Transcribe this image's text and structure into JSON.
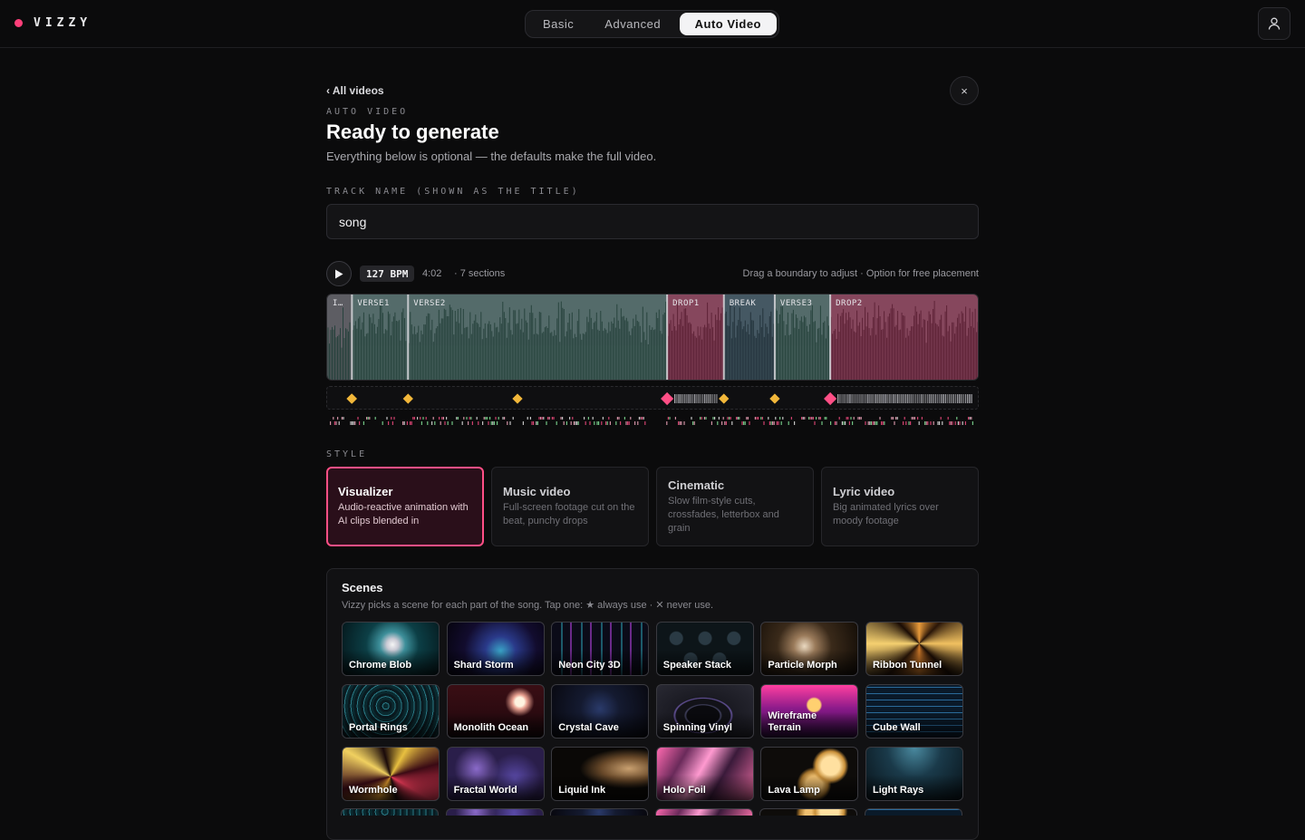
{
  "app": {
    "brand": "VIZZY",
    "brand_color": "#ff3f7a",
    "modes": [
      "Basic",
      "Advanced",
      "Auto Video"
    ],
    "active_mode": "Auto Video"
  },
  "header": {
    "back_label": "‹ All videos",
    "eyebrow": "AUTO VIDEO",
    "title": "Ready to generate",
    "subtitle": "Everything below is optional — the defaults make the full video.",
    "close_icon": "×"
  },
  "track": {
    "label": "TRACK NAME (SHOWN AS THE TITLE)",
    "value": "song"
  },
  "player": {
    "bpm": "127 BPM",
    "duration": "4:02",
    "sections_count": "· 7 sections",
    "hint": "Drag a boundary to adjust · Option for free placement"
  },
  "sections": [
    {
      "label": "I…",
      "start": 0.0,
      "end": 0.038,
      "kind": "intro"
    },
    {
      "label": "VERSE1",
      "start": 0.038,
      "end": 0.124,
      "kind": "verse"
    },
    {
      "label": "VERSE2",
      "start": 0.124,
      "end": 0.521,
      "kind": "verse"
    },
    {
      "label": "DROP1",
      "start": 0.521,
      "end": 0.608,
      "kind": "drop"
    },
    {
      "label": "BREAK",
      "start": 0.608,
      "end": 0.686,
      "kind": "break"
    },
    {
      "label": "VERSE3",
      "start": 0.686,
      "end": 0.771,
      "kind": "verse"
    },
    {
      "label": "DROP2",
      "start": 0.771,
      "end": 1.0,
      "kind": "drop"
    }
  ],
  "colors": {
    "intro": "#6a6a70",
    "verse": "#5f7a78",
    "drop": "#9a5068",
    "break": "#4e6470",
    "accent": "#ff4f86",
    "marker": "#f2b73a"
  },
  "style": {
    "label": "STYLE",
    "options": [
      {
        "name": "Visualizer",
        "desc": "Audio-reactive animation with AI clips blended in",
        "selected": true
      },
      {
        "name": "Music video",
        "desc": "Full-screen footage cut on the beat, punchy drops",
        "selected": false
      },
      {
        "name": "Cinematic",
        "desc": "Slow film-style cuts, crossfades, letterbox and grain",
        "selected": false
      },
      {
        "name": "Lyric video",
        "desc": "Big animated lyrics over moody footage",
        "selected": false
      }
    ]
  },
  "scenes": {
    "title": "Scenes",
    "hint": "Vizzy picks a scene for each part of the song. Tap one: ★ always use · ✕ never use.",
    "items": [
      {
        "name": "Chrome Blob",
        "bg": "bg-chrome-blob"
      },
      {
        "name": "Shard Storm",
        "bg": "bg-shard-storm"
      },
      {
        "name": "Neon City 3D",
        "bg": "bg-neon-city"
      },
      {
        "name": "Speaker Stack",
        "bg": "bg-speaker-stack"
      },
      {
        "name": "Particle Morph",
        "bg": "bg-particle-morph"
      },
      {
        "name": "Ribbon Tunnel",
        "bg": "bg-ribbon-tunnel"
      },
      {
        "name": "Portal Rings",
        "bg": "bg-portal-rings"
      },
      {
        "name": "Monolith Ocean",
        "bg": "bg-monolith-ocean"
      },
      {
        "name": "Crystal Cave",
        "bg": "bg-crystal-cave"
      },
      {
        "name": "Spinning Vinyl",
        "bg": "bg-spinning-vinyl"
      },
      {
        "name": "Wireframe Terrain",
        "bg": "bg-wireframe-terrain"
      },
      {
        "name": "Cube Wall",
        "bg": "bg-cube-wall"
      },
      {
        "name": "Wormhole",
        "bg": "bg-wormhole"
      },
      {
        "name": "Fractal World",
        "bg": "bg-fractal-world"
      },
      {
        "name": "Liquid Ink",
        "bg": "bg-liquid-ink"
      },
      {
        "name": "Holo Foil",
        "bg": "bg-holo-foil"
      },
      {
        "name": "Lava Lamp",
        "bg": "bg-lava-lamp"
      },
      {
        "name": "Light Rays",
        "bg": "bg-light-rays"
      }
    ]
  }
}
